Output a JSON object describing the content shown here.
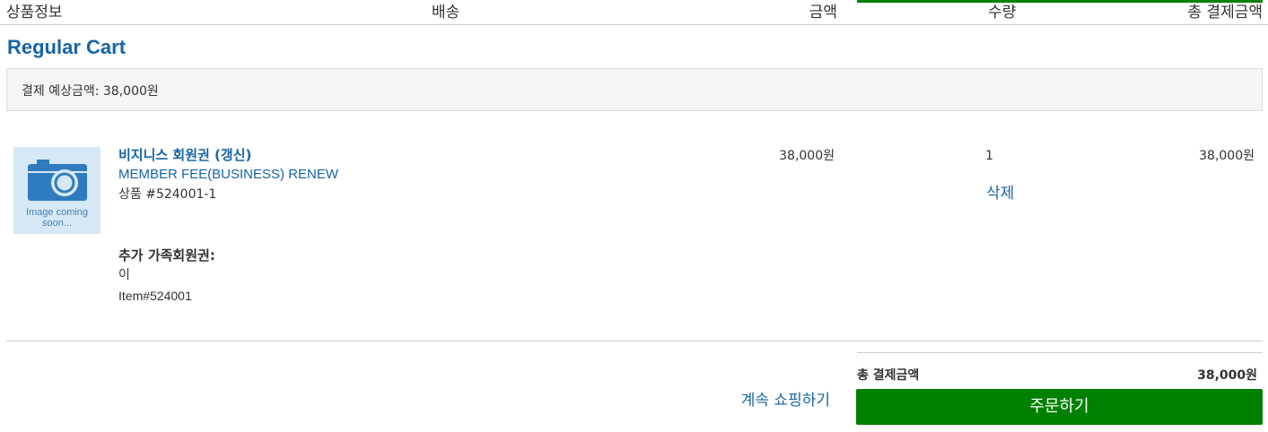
{
  "header": {
    "product_info": "상품정보",
    "shipping": "배송",
    "price": "금액",
    "quantity": "수량",
    "total": "총 결제금액"
  },
  "cart": {
    "title": "Regular Cart",
    "estimate_text": "결제 예상금액: 38,000원"
  },
  "items": [
    {
      "thumbnail_caption": "Image coming soon...",
      "thumbnail_icon": "camera-icon",
      "name": "비지니스 회원권 (갱신)",
      "subname": "MEMBER FEE(BUSINESS) RENEW",
      "sku": "상품 #524001-1",
      "option_label": "추가 가족회원권:",
      "option_value": "이",
      "option_item": "Item#524001",
      "price": "38,000원",
      "quantity": "1",
      "delete_label": "삭제",
      "line_total": "38,000원"
    }
  ],
  "summary": {
    "total_label": "총 결제금액",
    "total_value": "38,000원",
    "continue_shopping": "계속 쇼핑하기",
    "checkout_label": "주문하기"
  },
  "colors": {
    "accent_blue": "#1565a6",
    "checkout_green": "#008000",
    "thumbnail_bg": "#d6e8f6"
  }
}
